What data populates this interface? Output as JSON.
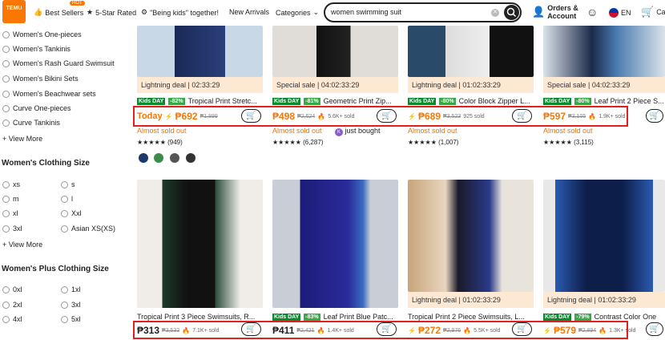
{
  "header": {
    "logo_text": "TEMU",
    "best_sellers": "Best Sellers",
    "hot": "HOT",
    "five_star": "5-Star Rated",
    "being_kids": "\"Being kids\" together!",
    "new_arrivals": "New Arrivals",
    "categories": "Categories",
    "search_value": "women swimming suit",
    "orders": "Orders &",
    "account": "Account",
    "lang": "EN",
    "cart_partial": "Ca"
  },
  "sidebar": {
    "styles": [
      "Women's One-pieces",
      "Women's Tankinis",
      "Women's Rash Guard Swimsuit",
      "Women's Bikini Sets",
      "Women's Beachwear sets",
      "Curve One-pieces",
      "Curve Tankinis"
    ],
    "view_more_1": "View More",
    "clothing_size_title": "Women's Clothing Size",
    "sizes": [
      "xs",
      "s",
      "m",
      "l",
      "xl",
      "Xxl",
      "3xl",
      "Asian XS(XS)"
    ],
    "view_more_2": "View More",
    "plus_title": "Women's Plus Clothing Size",
    "plus_sizes": [
      "0xl",
      "1xl",
      "2xl",
      "3xl",
      "4xl",
      "5xl"
    ]
  },
  "row1": [
    {
      "badge": "Lightning deal | 02:33:29",
      "kids": "Kids DAY",
      "discount": "-82%",
      "title": "Tropical Print Stretc...",
      "lead": "Today",
      "price": "₱692",
      "orig": "₱1,899",
      "sold": "",
      "almost": "Almost sold out",
      "stars": "★★★★★",
      "reviews": "(949)"
    },
    {
      "badge": "Special sale | 04:02:33:29",
      "kids": "Kids DAY",
      "discount": "-81%",
      "title": "Geometric Print Zip...",
      "lead": "",
      "price": "₱498",
      "orig": "₱2,624",
      "sold": "5.6K+ sold",
      "almost": "Almost sold out",
      "stars": "★★★★★",
      "reviews": "(6,287)",
      "bought": "just bought"
    },
    {
      "badge": "Lightning deal | 01:02:33:29",
      "kids": "Kids DAY",
      "discount": "-80%",
      "title": "Color Block Zipper L...",
      "lead": "",
      "price": "₱689",
      "orig": "₱3,523",
      "sold": "925 sold",
      "almost": "Almost sold out",
      "stars": "★★★★★",
      "reviews": "(1,007)"
    },
    {
      "badge": "Special sale | 04:02:33:29",
      "kids": "Kids DAY",
      "discount": "-80%",
      "title": "Leaf Print 2 Piece S...",
      "lead": "",
      "price": "₱597",
      "orig": "₱3,105",
      "sold": "1.9K+ sold",
      "almost": "Almost sold out",
      "stars": "★★★★★",
      "reviews": "(3,115)"
    }
  ],
  "row2": [
    {
      "badge": "",
      "kids": "",
      "discount": "",
      "title": "Tropical Print 3 Piece Swimsuits, R...",
      "price": "₱313",
      "orig": "₱3,532",
      "sold": "7.1K+ sold"
    },
    {
      "badge": "",
      "kids": "Kids DAY",
      "discount": "-83%",
      "title": "Leaf Print Blue Patc...",
      "price": "₱411",
      "orig": "₱2,421",
      "sold": "1.4K+ sold"
    },
    {
      "badge": "Lightning deal | 01:02:33:29",
      "kids": "",
      "discount": "",
      "title": "Tropical Print 2 Piece Swimsuits, L...",
      "price": "₱272",
      "orig": "₱2,976",
      "sold": "5.5K+ sold"
    },
    {
      "badge": "Lightning deal | 01:02:33:29",
      "kids": "Kids DAY",
      "discount": "-79%",
      "title": "Contrast Color One",
      "price": "₱579",
      "orig": "₱2,894",
      "sold": "1.3K+ sold"
    }
  ]
}
